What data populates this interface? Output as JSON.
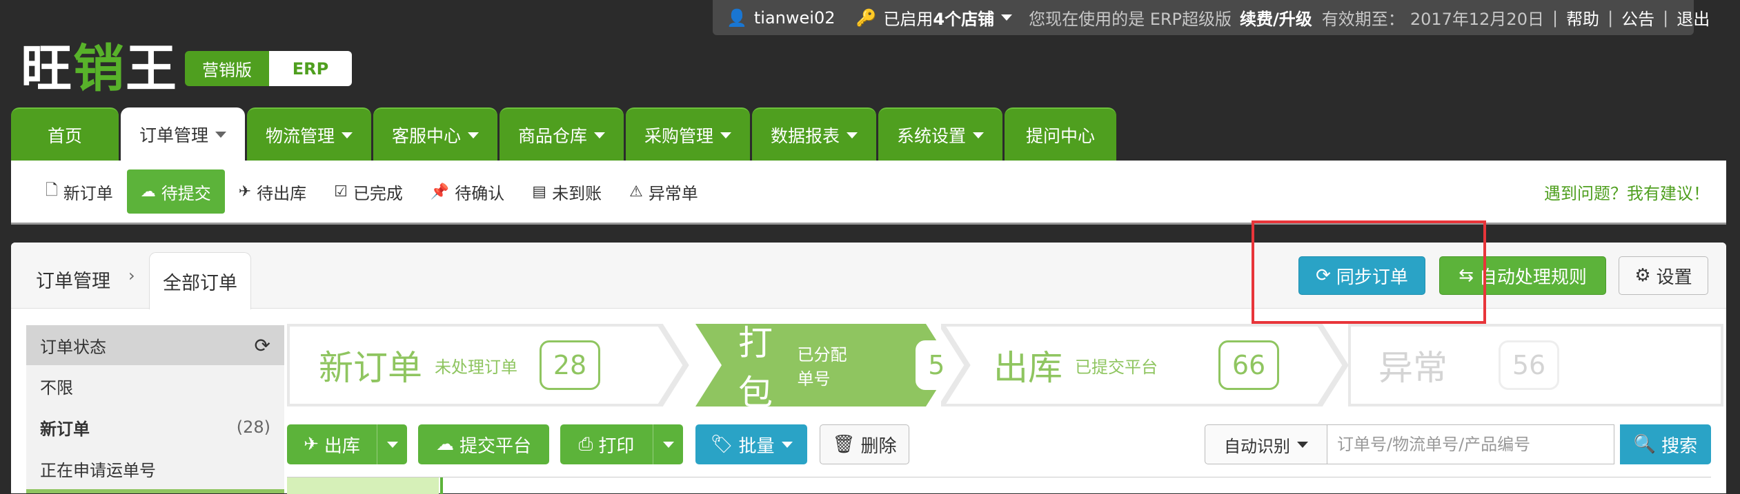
{
  "topbar": {
    "username": "tianwei02",
    "stores_prefix": "已启用",
    "stores_count": "4个店铺",
    "version_text": "您现在使用的是 ERP超级版",
    "renew": "续费/升级",
    "expiry": "有效期至：",
    "expiry_date": "2017年12月20日",
    "help": "帮助",
    "notice": "公告",
    "logout": "退出",
    "sep": "|"
  },
  "logo": {
    "part1": "旺",
    "part2": "销",
    "part3": "王"
  },
  "edition": {
    "marketing": "营销版",
    "erp": "ERP"
  },
  "mainnav": [
    "首页",
    "订单管理",
    "物流管理",
    "客服中心",
    "商品仓库",
    "采购管理",
    "数据报表",
    "系统设置",
    "提问中心"
  ],
  "subnav": {
    "items": [
      "新订单",
      "待提交",
      "待出库",
      "已完成",
      "待确认",
      "未到账",
      "异常单"
    ],
    "feedback": "遇到问题？我有建议！"
  },
  "breadcrumb": {
    "root": "订单管理",
    "arrow": "›",
    "current": "全部订单"
  },
  "actions": {
    "sync": "同步订单",
    "auto_rules": "自动处理规则",
    "settings": "设置"
  },
  "sidebar": {
    "header": "订单状态",
    "items": [
      {
        "label": "不限",
        "count": ""
      },
      {
        "label": "新订单",
        "count": "(28)"
      },
      {
        "label": "正在申请运单号",
        "count": ""
      }
    ]
  },
  "stages": [
    {
      "title": "新订单",
      "sub": "未处理订单",
      "count": "28"
    },
    {
      "title": "打包",
      "sub": "已分配单号",
      "count": "5"
    },
    {
      "title": "出库",
      "sub": "已提交平台",
      "count": "66"
    },
    {
      "title": "异常",
      "sub": "",
      "count": "56"
    }
  ],
  "toolbar": {
    "ship": "出库",
    "submit": "提交平台",
    "print": "打印",
    "batch": "批量",
    "delete": "删除",
    "auto_detect": "自动识别",
    "search_placeholder": "订单号/物流单号/产品编号",
    "search": "搜索"
  },
  "colors": {
    "brand_green": "#4f9f1f",
    "accent_blue": "#2aa3c6",
    "highlight_red": "#e8353a",
    "stage_active": "#8fc560"
  }
}
